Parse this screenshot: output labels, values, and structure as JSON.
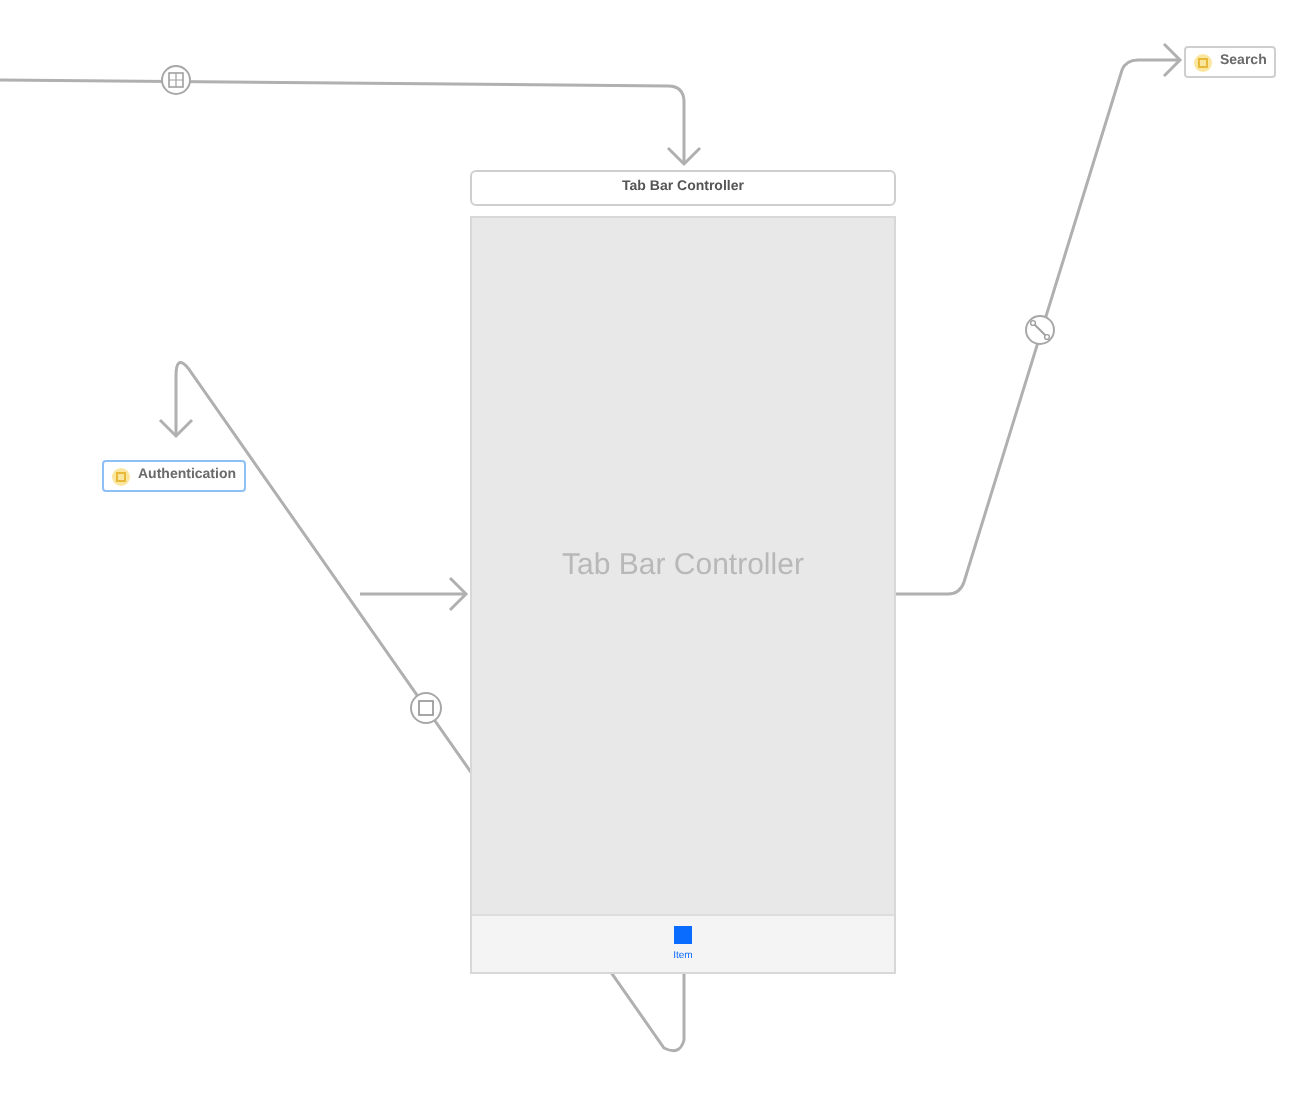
{
  "scene": {
    "title": "Tab Bar Controller",
    "label": "Tab Bar Controller",
    "tab_items": [
      {
        "label": "Item",
        "selected": true
      }
    ]
  },
  "references": [
    {
      "label": "Authentication",
      "selected": true
    },
    {
      "label": "Search",
      "selected": false
    }
  ]
}
